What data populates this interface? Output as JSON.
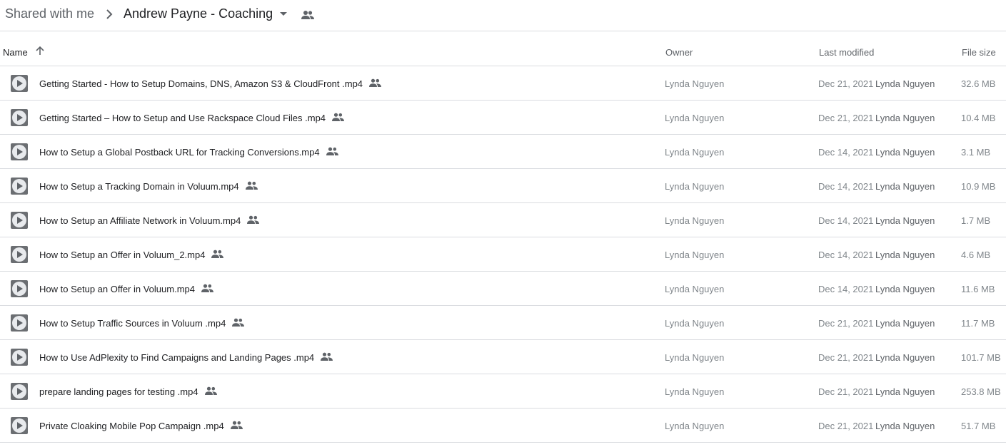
{
  "breadcrumb": {
    "root": "Shared with me",
    "current": "Andrew Payne - Coaching"
  },
  "columns": {
    "name": "Name",
    "owner": "Owner",
    "last_modified": "Last modified",
    "file_size": "File size"
  },
  "icons": {
    "shared": "people-icon",
    "sort": "arrow-up-icon",
    "video": "video-play-icon"
  },
  "files": [
    {
      "name": "Getting Started - How to Setup Domains, DNS, Amazon S3 & CloudFront .mp4",
      "owner": "Lynda Nguyen",
      "modified_date": "Dec 21, 2021",
      "modified_by": "Lynda Nguyen",
      "size": "32.6 MB"
    },
    {
      "name": "Getting Started – How to Setup and Use Rackspace Cloud Files .mp4",
      "owner": "Lynda Nguyen",
      "modified_date": "Dec 21, 2021",
      "modified_by": "Lynda Nguyen",
      "size": "10.4 MB"
    },
    {
      "name": "How to Setup a Global Postback URL for Tracking Conversions.mp4",
      "owner": "Lynda Nguyen",
      "modified_date": "Dec 14, 2021",
      "modified_by": "Lynda Nguyen",
      "size": "3.1 MB"
    },
    {
      "name": "How to Setup a Tracking Domain in Voluum.mp4",
      "owner": "Lynda Nguyen",
      "modified_date": "Dec 14, 2021",
      "modified_by": "Lynda Nguyen",
      "size": "10.9 MB"
    },
    {
      "name": "How to Setup an Affiliate Network in Voluum.mp4",
      "owner": "Lynda Nguyen",
      "modified_date": "Dec 14, 2021",
      "modified_by": "Lynda Nguyen",
      "size": "1.7 MB"
    },
    {
      "name": "How to Setup an Offer in Voluum_2.mp4",
      "owner": "Lynda Nguyen",
      "modified_date": "Dec 14, 2021",
      "modified_by": "Lynda Nguyen",
      "size": "4.6 MB"
    },
    {
      "name": "How to Setup an Offer in Voluum.mp4",
      "owner": "Lynda Nguyen",
      "modified_date": "Dec 14, 2021",
      "modified_by": "Lynda Nguyen",
      "size": "11.6 MB"
    },
    {
      "name": "How to Setup Traffic Sources in Voluum .mp4",
      "owner": "Lynda Nguyen",
      "modified_date": "Dec 21, 2021",
      "modified_by": "Lynda Nguyen",
      "size": "11.7 MB"
    },
    {
      "name": "How to Use AdPlexity to Find Campaigns and Landing Pages .mp4",
      "owner": "Lynda Nguyen",
      "modified_date": "Dec 21, 2021",
      "modified_by": "Lynda Nguyen",
      "size": "101.7 MB"
    },
    {
      "name": "prepare landing pages for testing .mp4",
      "owner": "Lynda Nguyen",
      "modified_date": "Dec 21, 2021",
      "modified_by": "Lynda Nguyen",
      "size": "253.8 MB"
    },
    {
      "name": "Private Cloaking Mobile Pop Campaign .mp4",
      "owner": "Lynda Nguyen",
      "modified_date": "Dec 21, 2021",
      "modified_by": "Lynda Nguyen",
      "size": "51.7 MB"
    }
  ]
}
